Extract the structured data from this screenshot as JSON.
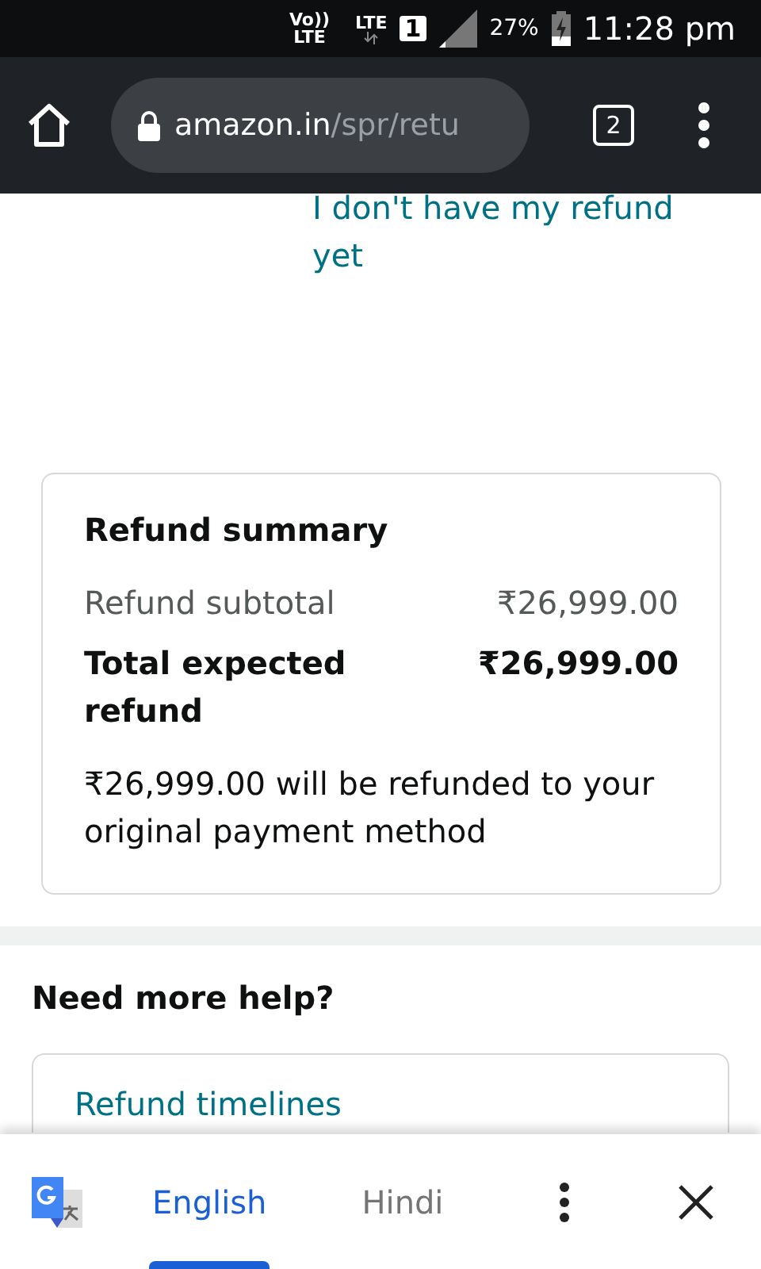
{
  "status_bar": {
    "volte": "Vo))",
    "volte_sub": "LTE",
    "network": "LTE",
    "sim": "1",
    "battery": "27%",
    "time": "11:28 pm"
  },
  "browser": {
    "url_host": "amazon.in",
    "url_path": "/spr/retu",
    "tab_count": "2"
  },
  "refund_link": "I don't have my refund yet",
  "refund_summary": {
    "title": "Refund summary",
    "rows": [
      {
        "label": "Refund subtotal",
        "value": "₹26,999.00",
        "kind": "normal"
      },
      {
        "label": "Total expected refund",
        "value": "₹26,999.00",
        "kind": "total"
      }
    ],
    "note": "₹26,999.00 will be refunded to your original payment method"
  },
  "help": {
    "title": "Need more help?",
    "items": [
      "Refund timelines"
    ]
  },
  "translate_bar": {
    "tabs": [
      {
        "label": "English",
        "selected": true
      },
      {
        "label": "Hindi",
        "selected": false
      }
    ]
  }
}
